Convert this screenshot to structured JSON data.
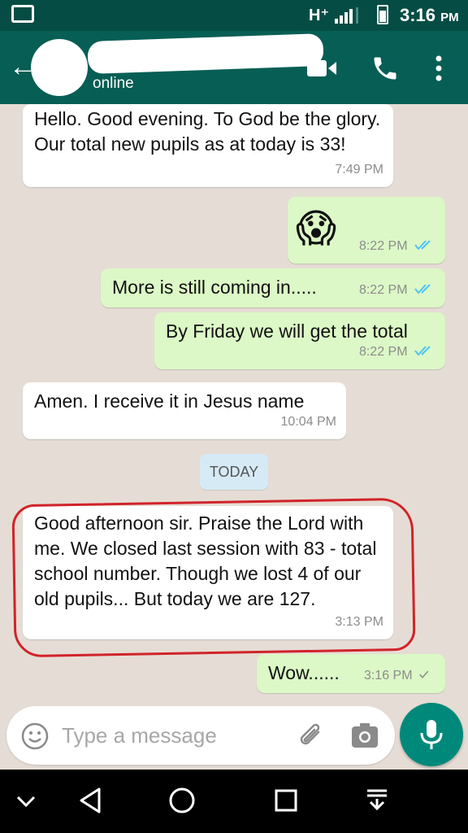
{
  "status_bar": {
    "network": "H⁺",
    "time": "3:16",
    "ampm": "PM"
  },
  "header": {
    "contact_status": "online"
  },
  "messages": [
    {
      "direction": "in",
      "text": "Hello.  Good evening. To God be the glory.  Our total new pupils as at today is 33!",
      "time": "7:49 PM"
    },
    {
      "direction": "out",
      "text": "😱",
      "time": "8:22 PM",
      "receipt": "read"
    },
    {
      "direction": "out",
      "text": "More is still coming in.....",
      "time": "8:22 PM",
      "receipt": "read"
    },
    {
      "direction": "out",
      "text": "By Friday we will get the total",
      "time": "8:22 PM",
      "receipt": "read"
    },
    {
      "direction": "in",
      "text": "Amen.  I receive it in Jesus name",
      "time": "10:04 PM"
    },
    {
      "direction": "in",
      "text": "Good afternoon sir.  Praise the Lord with me. We closed last session with 83 - total school number.  Though we lost 4 of our old pupils... But today we are 127.",
      "time": "3:13 PM",
      "annotated": true
    },
    {
      "direction": "out",
      "text": "Wow......",
      "time": "3:16 PM",
      "receipt": "delivered"
    }
  ],
  "day_divider": "TODAY",
  "composer": {
    "placeholder": "Type a message"
  },
  "colors": {
    "header": "#075e54",
    "status_bar": "#054d44",
    "outgoing": "#dcf8c6",
    "incoming": "#ffffff",
    "read_tick": "#4fc3f7",
    "annotation": "#d1232a",
    "fab": "#00897b"
  }
}
